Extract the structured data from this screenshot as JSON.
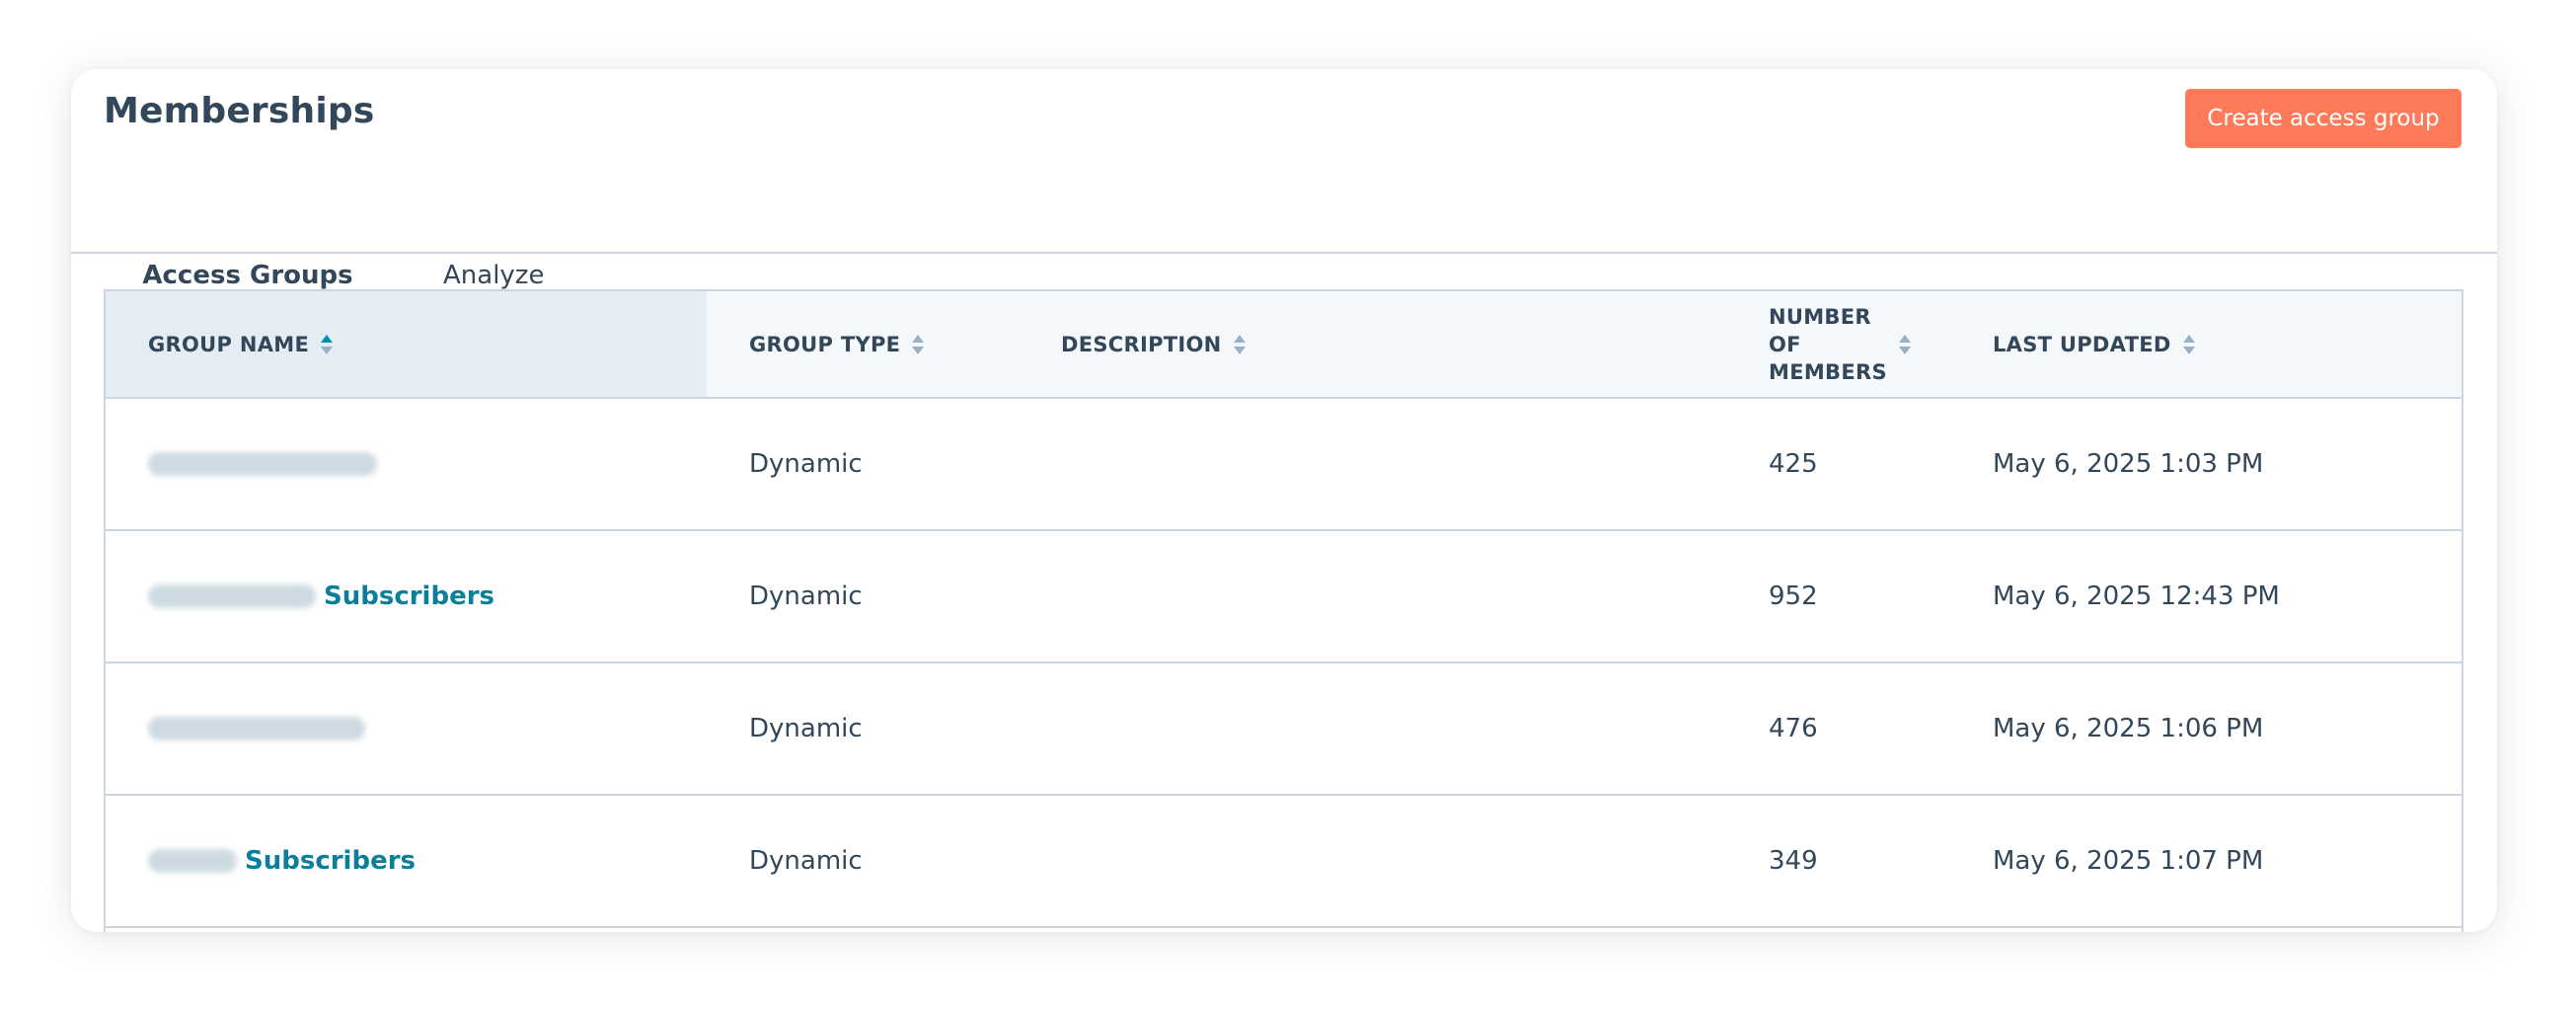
{
  "page": {
    "title": "Memberships",
    "create_button_label": "Create access group"
  },
  "tabs": [
    {
      "label": "Access Groups",
      "active": true
    },
    {
      "label": "Analyze",
      "active": false
    }
  ],
  "table": {
    "columns": [
      {
        "label": "GROUP NAME",
        "sorted": "ascending"
      },
      {
        "label": "GROUP TYPE",
        "sorted": "none"
      },
      {
        "label": "DESCRIPTION",
        "sorted": "none"
      },
      {
        "label": "NUMBER OF MEMBERS",
        "sorted": "none"
      },
      {
        "label": "LAST UPDATED",
        "sorted": "none"
      }
    ],
    "rows": [
      {
        "name_visible": "",
        "name_redacted": true,
        "type": "Dynamic",
        "description": "",
        "members": "425",
        "last_updated": "May 6, 2025 1:03 PM"
      },
      {
        "name_visible": "Subscribers",
        "name_redacted": true,
        "type": "Dynamic",
        "description": "",
        "members": "952",
        "last_updated": "May 6, 2025 12:43 PM"
      },
      {
        "name_visible": "",
        "name_redacted": true,
        "type": "Dynamic",
        "description": "",
        "members": "476",
        "last_updated": "May 6, 2025 1:06 PM"
      },
      {
        "name_visible": "Subscribers",
        "name_redacted": true,
        "type": "Dynamic",
        "description": "",
        "members": "349",
        "last_updated": "May 6, 2025 1:07 PM"
      }
    ]
  },
  "colors": {
    "primary_button": "#ff7a59",
    "link": "#0b7f99",
    "text": "#33475b",
    "border": "#cbd6e2",
    "header_bg": "#f5f8fa",
    "sorted_header_bg": "#e5ecf3",
    "sort_active": "#0091ae"
  },
  "icons": {
    "sort": "sort-arrows-icon"
  }
}
